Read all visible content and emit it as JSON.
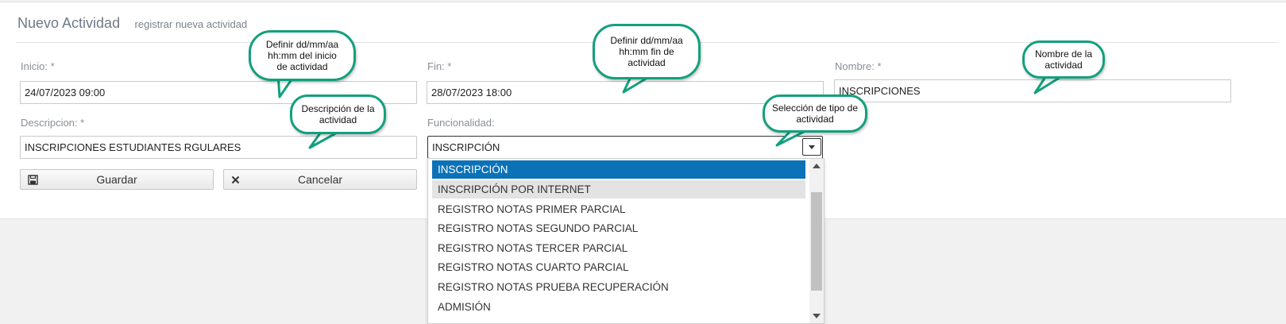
{
  "header": {
    "title": "Nuevo Actividad",
    "subtitle": "registrar nueva actividad"
  },
  "form": {
    "inicio": {
      "label": "Inicio: *",
      "value": "24/07/2023 09:00"
    },
    "fin": {
      "label": "Fin: *",
      "value": "28/07/2023 18:00"
    },
    "nombre": {
      "label": "Nombre: *",
      "value": "INSCRIPCIONES"
    },
    "descripcion": {
      "label": "Descripcion: *",
      "value": "INSCRIPCIONES ESTUDIANTES RGULARES"
    },
    "funcionalidad": {
      "label": "Funcionalidad:",
      "value": "INSCRIPCIÓN"
    }
  },
  "buttons": {
    "save": "Guardar",
    "cancel": "Cancelar"
  },
  "dropdown": {
    "options": [
      "INSCRIPCIÓN",
      "INSCRIPCIÓN POR INTERNET",
      "REGISTRO NOTAS PRIMER PARCIAL",
      "REGISTRO NOTAS SEGUNDO PARCIAL",
      "REGISTRO NOTAS TERCER PARCIAL",
      "REGISTRO NOTAS CUARTO PARCIAL",
      "REGISTRO NOTAS PRUEBA RECUPERACIÓN",
      "ADMISIÓN"
    ],
    "selected_index": 0,
    "hover_index": 1
  },
  "callouts": {
    "inicio": "Definir dd/mm/aa hh:mm  del inicio de actividad",
    "fin": "Definir dd/mm/aa hh:mm  fin de actividad",
    "nombre": "Nombre de la actividad",
    "descripcion": "Descripción  de la actividad",
    "funcionalidad": "Selección de tipo de actividad"
  },
  "icons": {
    "save": "floppy-disk-icon",
    "cancel": "x-icon"
  },
  "colors": {
    "selected": "#0b72b8",
    "callout_border": "#13a07e"
  }
}
